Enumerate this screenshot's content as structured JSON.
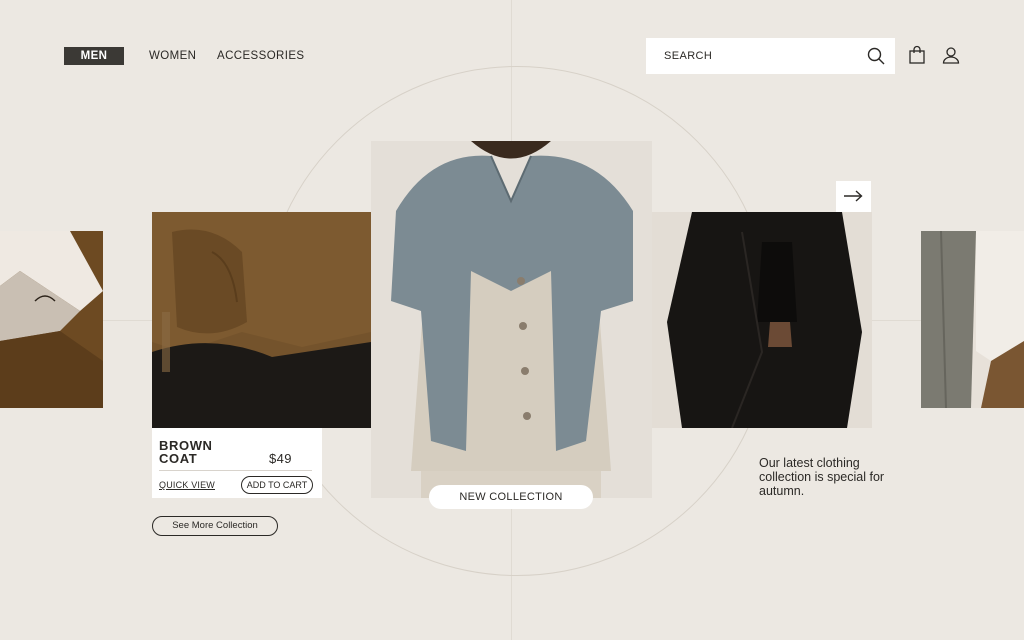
{
  "nav": {
    "items": [
      {
        "label": "MEN",
        "active": true
      },
      {
        "label": "WOMEN",
        "active": false
      },
      {
        "label": "ACCESSORIES",
        "active": false
      }
    ]
  },
  "search": {
    "placeholder": "SEARCH"
  },
  "icons": {
    "search": "search-icon",
    "bag": "shopping-bag-icon",
    "user": "user-icon",
    "next": "arrow-right-icon"
  },
  "product": {
    "name": "BROWN COAT",
    "price": "$49",
    "quick_view": "QUICK VIEW",
    "add_to_cart": "ADD TO CART"
  },
  "see_more": "See More Collection",
  "badge": "NEW COLLECTION",
  "tagline": "Our latest clothing collection is special for autumn.",
  "colors": {
    "background": "#ece8e2",
    "active_nav": "#3b3935",
    "text": "#2b2926"
  }
}
